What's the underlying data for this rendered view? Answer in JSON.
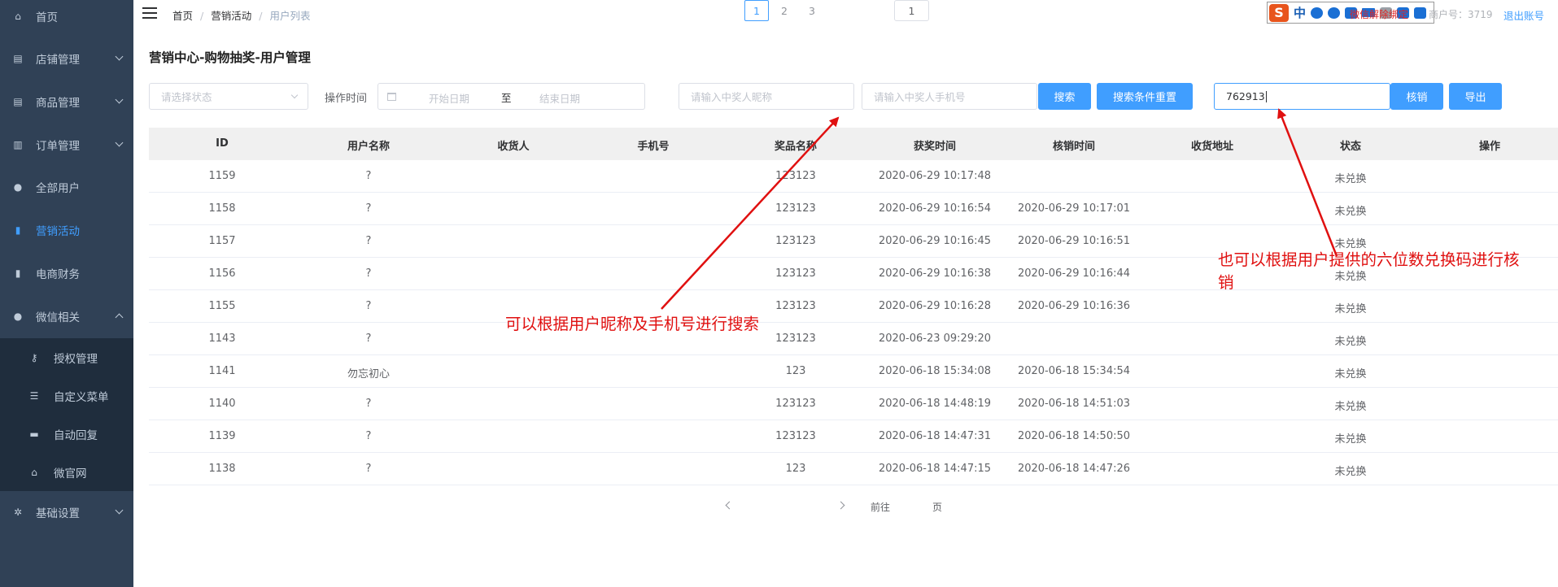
{
  "sidebar": {
    "items": [
      {
        "label": "首页",
        "icon": "home-icon"
      },
      {
        "label": "店铺管理",
        "icon": "store-icon"
      },
      {
        "label": "商品管理",
        "icon": "goods-icon"
      },
      {
        "label": "订单管理",
        "icon": "order-icon"
      },
      {
        "label": "全部用户",
        "icon": "users-icon"
      },
      {
        "label": "营销活动",
        "icon": "chart-icon",
        "active": true
      },
      {
        "label": "电商财务",
        "icon": "finance-icon"
      },
      {
        "label": "微信相关",
        "icon": "wechat-icon",
        "expanded": true
      },
      {
        "label": "基础设置",
        "icon": "gear-icon"
      }
    ],
    "submenu": [
      {
        "label": "授权管理",
        "icon": "key-icon"
      },
      {
        "label": "自定义菜单",
        "icon": "list-icon"
      },
      {
        "label": "自动回复",
        "icon": "chat-icon"
      },
      {
        "label": "微官网",
        "icon": "home-icon"
      }
    ]
  },
  "header": {
    "breadcrumb": [
      "首页",
      "营销活动",
      "用户列表"
    ],
    "ime_logo": "S",
    "ime_mode": "中",
    "unbind_wechat": "微信解除绑定",
    "merchant_id": "商户号：3719",
    "logout": "退出账号"
  },
  "page_title": "营销中心-购物抽奖-用户管理",
  "filters": {
    "status_placeholder": "请选择状态",
    "time_label": "操作时间",
    "start_date_placeholder": "开始日期",
    "range_separator": "至",
    "end_date_placeholder": "结束日期",
    "nickname_placeholder": "请输入中奖人昵称",
    "phone_placeholder": "请输入中奖人手机号",
    "search_button": "搜索",
    "reset_button": "搜索条件重置",
    "code_value": "762913",
    "verify_button": "核销",
    "export_button": "导出"
  },
  "table": {
    "columns": [
      "ID",
      "用户名称",
      "收货人",
      "手机号",
      "奖品名称",
      "获奖时间",
      "核销时间",
      "收货地址",
      "状态",
      "操作"
    ],
    "rows": [
      [
        "1159",
        "?",
        "",
        "",
        "123123",
        "2020-06-29 10:17:48",
        "",
        "",
        "未兑换",
        ""
      ],
      [
        "1158",
        "?",
        "",
        "",
        "123123",
        "2020-06-29 10:16:54",
        "2020-06-29 10:17:01",
        "",
        "未兑换",
        ""
      ],
      [
        "1157",
        "?",
        "",
        "",
        "123123",
        "2020-06-29 10:16:45",
        "2020-06-29 10:16:51",
        "",
        "未兑换",
        ""
      ],
      [
        "1156",
        "?",
        "",
        "",
        "123123",
        "2020-06-29 10:16:38",
        "2020-06-29 10:16:44",
        "",
        "未兑换",
        ""
      ],
      [
        "1155",
        "?",
        "",
        "",
        "123123",
        "2020-06-29 10:16:28",
        "2020-06-29 10:16:36",
        "",
        "未兑换",
        ""
      ],
      [
        "1143",
        "?",
        "",
        "",
        "123123",
        "2020-06-23 09:29:20",
        "",
        "",
        "未兑换",
        ""
      ],
      [
        "1141",
        "勿忘初心",
        "",
        "",
        "123",
        "2020-06-18 15:34:08",
        "2020-06-18 15:34:54",
        "",
        "未兑换",
        ""
      ],
      [
        "1140",
        "?",
        "",
        "",
        "123123",
        "2020-06-18 14:48:19",
        "2020-06-18 14:51:03",
        "",
        "未兑换",
        ""
      ],
      [
        "1139",
        "?",
        "",
        "",
        "123123",
        "2020-06-18 14:47:31",
        "2020-06-18 14:50:50",
        "",
        "未兑换",
        ""
      ],
      [
        "1138",
        "?",
        "",
        "",
        "123",
        "2020-06-18 14:47:15",
        "2020-06-18 14:47:26",
        "",
        "未兑换",
        ""
      ]
    ]
  },
  "pagination": {
    "pages": [
      "1",
      "2",
      "3"
    ],
    "current": "1",
    "goto_label": "前往",
    "goto_value": "1",
    "page_suffix": "页"
  },
  "annotations": {
    "search_hint": "可以根据用户昵称及手机号进行搜索",
    "verify_hint_line1": "也可以根据用户提供的六位数兑换码进行核",
    "verify_hint_line2": "销",
    "color": "#e01010"
  }
}
